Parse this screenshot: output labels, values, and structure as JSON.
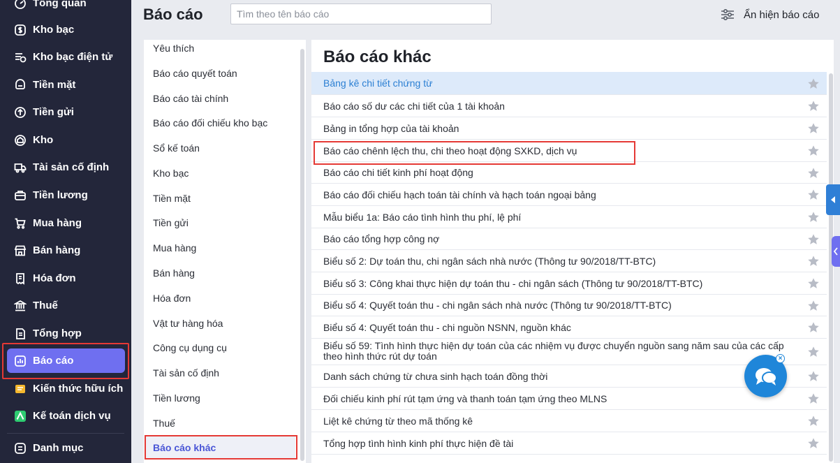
{
  "sidebar": {
    "items": [
      {
        "label": "Tổng quan",
        "icon": "dashboard-icon"
      },
      {
        "label": "Kho bạc",
        "icon": "dollar-circle-icon"
      },
      {
        "label": "Kho bạc điện tử",
        "icon": "digital-treasury-icon"
      },
      {
        "label": "Tiền mặt",
        "icon": "cash-icon"
      },
      {
        "label": "Tiền gửi",
        "icon": "deposit-icon"
      },
      {
        "label": "Kho",
        "icon": "warehouse-icon"
      },
      {
        "label": "Tài sản cố định",
        "icon": "truck-icon"
      },
      {
        "label": "Tiền lương",
        "icon": "salary-icon"
      },
      {
        "label": "Mua hàng",
        "icon": "cart-icon"
      },
      {
        "label": "Bán hàng",
        "icon": "store-icon"
      },
      {
        "label": "Hóa đơn",
        "icon": "invoice-icon"
      },
      {
        "label": "Thuế",
        "icon": "bank-icon"
      },
      {
        "label": "Tổng hợp",
        "icon": "summary-icon"
      },
      {
        "label": "Báo cáo",
        "icon": "chart-icon"
      },
      {
        "label": "Kiến thức hữu ích",
        "icon": "knowledge-icon"
      },
      {
        "label": "Kế toán dịch vụ",
        "icon": "service-icon"
      },
      {
        "label": "Danh mục",
        "icon": "list-icon"
      }
    ],
    "active": "Báo cáo",
    "accent_color": "#6f6ff0"
  },
  "header": {
    "title": "Báo cáo",
    "search_placeholder": "Tìm theo tên báo cáo",
    "toggle_label": "Ẩn hiện báo cáo"
  },
  "categories": {
    "items": [
      "Yêu thích",
      "Báo cáo quyết toán",
      "Báo cáo tài chính",
      "Báo cáo đối chiếu kho bạc",
      "Sổ kế toán",
      "Kho bạc",
      "Tiền mặt",
      "Tiền gửi",
      "Mua hàng",
      "Bán hàng",
      "Hóa đơn",
      "Vật tư hàng hóa",
      "Công cụ dụng cụ",
      "Tài sản cố định",
      "Tiền lương",
      "Thuế",
      "Báo cáo khác"
    ],
    "active": "Báo cáo khác"
  },
  "reports": {
    "title": "Báo cáo khác",
    "items": [
      "Bảng kê chi tiết chứng từ",
      "Báo cáo số dư các chi tiết của 1 tài khoản",
      "Bảng in tổng hợp của tài khoản",
      "Báo cáo chênh lệch thu, chi theo hoạt động SXKD, dịch vụ",
      "Báo cáo chi tiết kinh phí hoạt động",
      "Báo cáo đối chiếu hạch toán tài chính và hạch toán ngoại bảng",
      "Mẫu biểu 1a: Báo cáo tình hình thu phí, lệ phí",
      "Báo cáo tổng hợp công nợ",
      "Biểu số 2: Dự toán thu, chi ngân sách nhà nước (Thông tư 90/2018/TT-BTC)",
      "Biểu số 3: Công khai thực hiện dự toán thu - chi ngân sách (Thông tư 90/2018/TT-BTC)",
      "Biểu số 4: Quyết toán thu - chi ngân sách nhà nước (Thông tư 90/2018/TT-BTC)",
      "Biểu số 4: Quyết toán thu - chi nguồn NSNN, nguồn khác",
      "Biểu số 59: Tình hình thực hiện dự toán của các nhiệm vụ được chuyển nguồn sang năm sau của các cấp theo hình thức rút dự toán",
      "Danh sách chứng từ chưa sinh hạch toán đồng thời",
      "Đối chiếu kinh phí rút tạm ứng và thanh toán tạm ứng theo MLNS",
      "Liệt kê chứng từ theo mã thống kê",
      "Tổng hợp tình hình kinh phí thực hiện đề tài"
    ],
    "selected": "Bảng kê chi tiết chứng từ",
    "star_color": "#b8bcc6"
  }
}
